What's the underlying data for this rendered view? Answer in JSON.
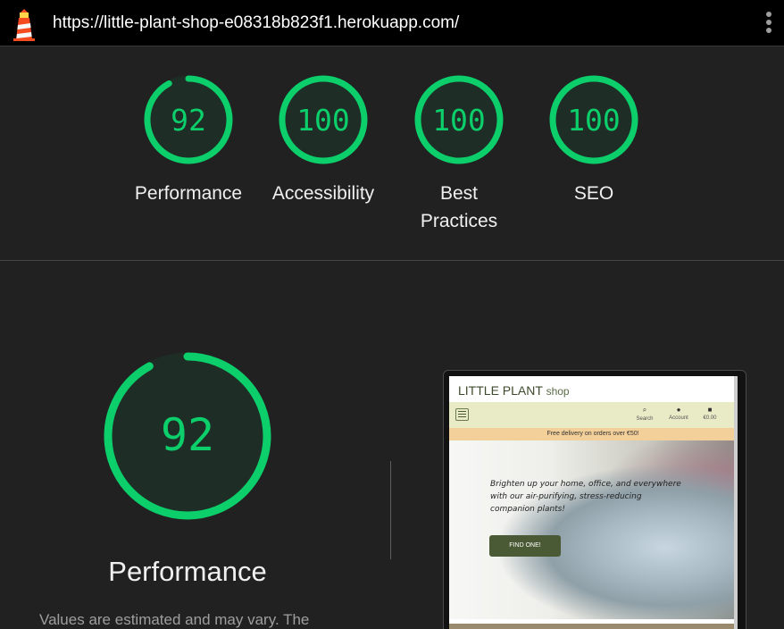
{
  "topbar": {
    "url": "https://little-plant-shop-e08318b823f1.herokuapp.com/",
    "logo_icon": "lighthouse-icon",
    "menu_icon": "kebab-menu-icon"
  },
  "colors": {
    "pass": "#0cce6b",
    "background": "#212121",
    "accent_button": "#4a5a35"
  },
  "scores": [
    {
      "value": "92",
      "percent": 92,
      "label_lines": [
        "Performance"
      ]
    },
    {
      "value": "100",
      "percent": 100,
      "label_lines": [
        "Accessibility"
      ]
    },
    {
      "value": "100",
      "percent": 100,
      "label_lines": [
        "Best",
        "Practices"
      ]
    },
    {
      "value": "100",
      "percent": 100,
      "label_lines": [
        "SEO"
      ]
    }
  ],
  "performance": {
    "value": "92",
    "percent": 92,
    "title": "Performance",
    "description": "Values are estimated and may vary. The"
  },
  "screenshot": {
    "brand": "LITTLE PLANT",
    "brand_suffix": "shop",
    "nav": [
      {
        "icon": "search-icon",
        "label": "Search"
      },
      {
        "icon": "user-icon",
        "label": "Account"
      },
      {
        "icon": "bag-icon",
        "label": "€0.00"
      }
    ],
    "banner": "Free delivery on orders over €50!",
    "hero_text": "Brighten up your home, office, and everywhere with our air-purifying, stress-reducing companion plants!",
    "cta": "FIND ONE!"
  }
}
